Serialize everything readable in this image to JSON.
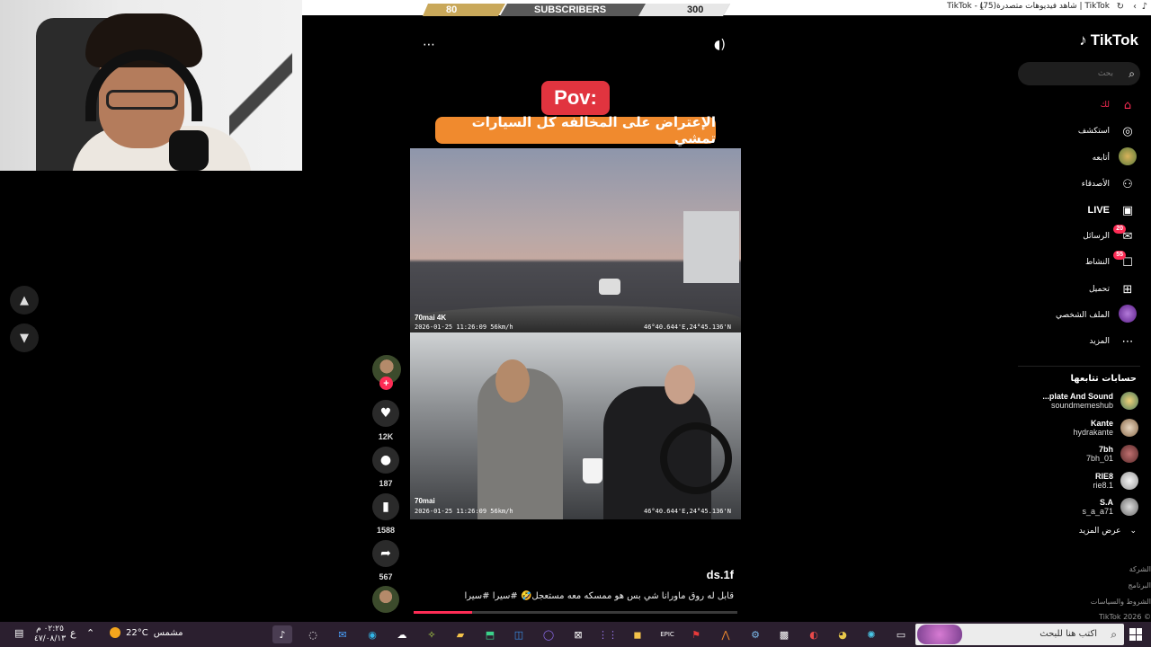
{
  "browser": {
    "tab_title": "TikTok | شاهد فيديوهات متصدرة(75) - TikTok"
  },
  "subscribers": {
    "current": "80",
    "label": "SUBSCRIBERS",
    "goal": "300"
  },
  "video": {
    "pov_label": "Pov:",
    "overlay_text": "الإعتراض على المخالفه كل السيارات تمشي",
    "dashcam_brand": "70mai",
    "dashcam_res": "4K",
    "dashcam_top_stamp": "2026-01-25 11:26:09  56km/h",
    "dashcam_top_coords": "46°40.644'E,24°45.136'N",
    "dashcam_bottom_stamp": "2026-01-25 11:26:09  56km/h",
    "dashcam_bottom_coords": "46°40.644'E,24°45.136'N",
    "author": "ds.1f",
    "description": "قابل له روق ماورانا شي بس هو ممسكه معه مستعجل🤣 #سيرا #سيرا",
    "progress": 0.18
  },
  "actions": {
    "likes": "12K",
    "comments": "187",
    "saves": "1588",
    "shares": "567",
    "follow_plus": "+"
  },
  "sidebar": {
    "logo": "TikTok",
    "search_placeholder": "بحث",
    "nav": {
      "home": "لك",
      "explore": "استكشف",
      "following": "أتابعه",
      "friends": "الأصدقاء",
      "live": "LIVE",
      "messages": "الرسائل",
      "messages_badge": "20",
      "activity": "النشاط",
      "activity_badge": "55",
      "upload": "تحميل",
      "profile": "الملف الشخصي",
      "more": "المزيد"
    },
    "following_title": "حسابات تتابعها",
    "accounts": [
      {
        "name": "...plate And Sound",
        "handle": "soundmemeshub"
      },
      {
        "name": "Kante",
        "handle": "hydrakante"
      },
      {
        "name": "7bh",
        "handle": "7bh_01"
      },
      {
        "name": "RIE8",
        "handle": "rie8.1"
      },
      {
        "name": "S.A",
        "handle": "s_a_a71"
      }
    ],
    "see_more": "عرض المزيد",
    "footer": [
      "الشركة",
      "البرنامج",
      "الشروط والسياسات",
      "TikTok 2026 ©"
    ]
  },
  "taskbar": {
    "search_placeholder": "اكتب هنا للبحث",
    "weather_temp": "22°C",
    "weather_label": "مشمس",
    "time": "٠٢:٢٥ م",
    "date": "٤٧/٠٨/١٣",
    "lang": "ع"
  }
}
